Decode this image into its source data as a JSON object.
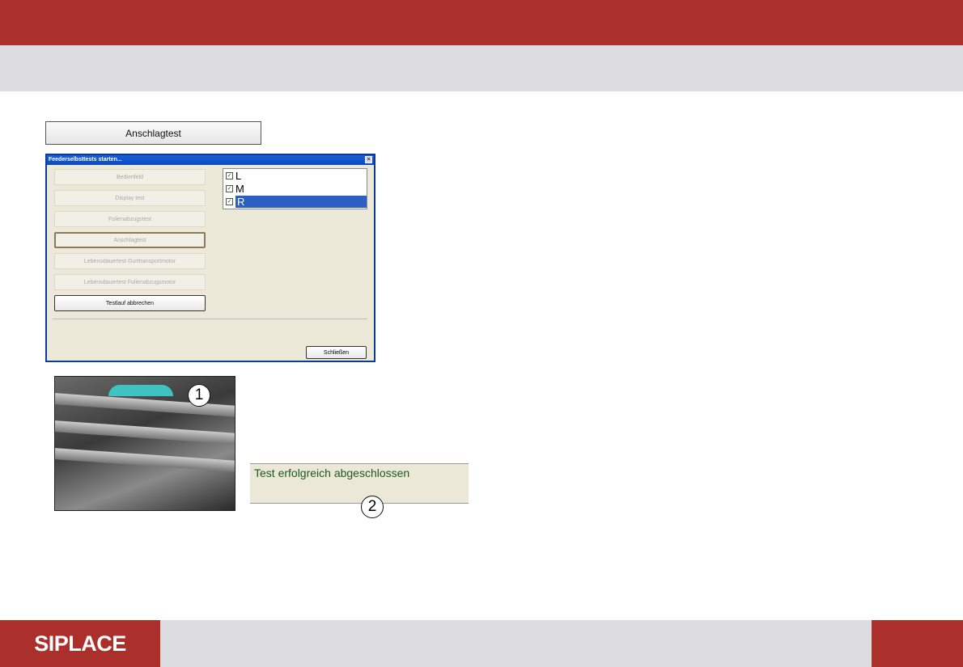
{
  "header": {
    "title": ""
  },
  "anschlag_button": "Anschlagtest",
  "dialog": {
    "title": "Feederselbsttests starten...",
    "close_glyph": "×",
    "buttons": [
      "Bedienfeld",
      "Display test",
      "Folienabzugstest",
      "Anschlagtest",
      "Lebensdauertest Gurttransportmotor",
      "Lebensdauertest Folienabzugsmotor",
      "Testlauf abbrechen"
    ],
    "tracks": [
      {
        "label": "L",
        "checked": true
      },
      {
        "label": "M",
        "checked": true
      },
      {
        "label": "R",
        "checked": true,
        "selected": true
      }
    ],
    "check_glyph": "✓",
    "close_button": "Schließen"
  },
  "callouts": [
    "1",
    "2"
  ],
  "status_message": "Test erfolgreich abgeschlossen",
  "footer": {
    "logo": "SIPLACE"
  },
  "colors": {
    "brand": "#ab2f2b",
    "bar": "#dddce0",
    "selection": "#2b5fc2"
  }
}
